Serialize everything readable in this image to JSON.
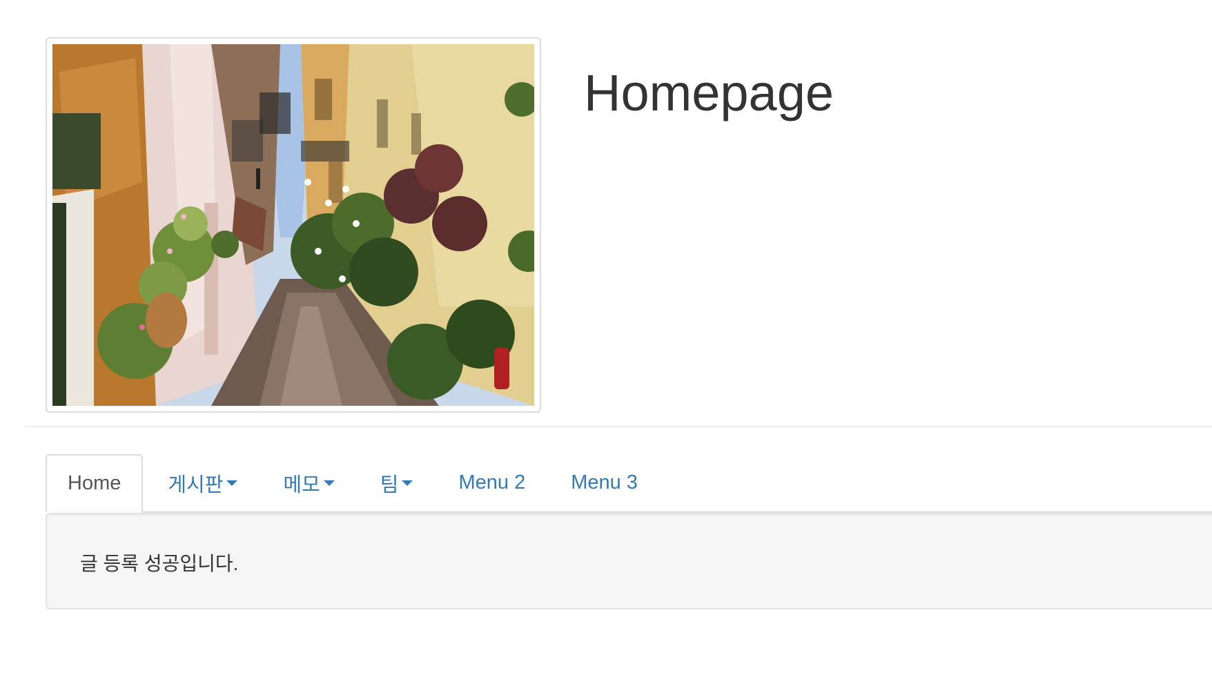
{
  "header": {
    "title": "Homepage",
    "image_alt": "narrow alley street with flowers"
  },
  "nav": {
    "tabs": [
      {
        "label": "Home",
        "active": true,
        "dropdown": false
      },
      {
        "label": "게시판",
        "active": false,
        "dropdown": true
      },
      {
        "label": "메모",
        "active": false,
        "dropdown": true
      },
      {
        "label": "팀",
        "active": false,
        "dropdown": true
      },
      {
        "label": "Menu 2",
        "active": false,
        "dropdown": false
      },
      {
        "label": "Menu 3",
        "active": false,
        "dropdown": false
      }
    ]
  },
  "message": {
    "text": "글 등록 성공입니다."
  },
  "colors": {
    "link": "#337ab7",
    "active_tab_text": "#555555",
    "well_bg": "#f5f5f5",
    "border": "#dddddd"
  },
  "icons": {
    "dropdown": "caret-down-icon"
  }
}
